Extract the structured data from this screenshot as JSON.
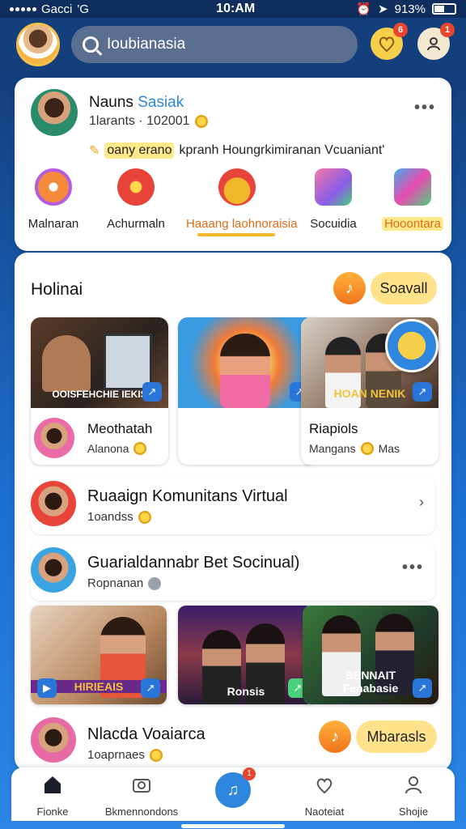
{
  "status_bar": {
    "carrier": "Gacci",
    "network": "'G",
    "time": "10:AM",
    "battery": "913%"
  },
  "header": {
    "search_placeholder": "Ioubianasia",
    "notif_badge": "6",
    "profile_badge": "1"
  },
  "profile": {
    "name": "Nauns",
    "name_accent": "Sasiak",
    "meta": "1larants · 102001",
    "promo_highlight": "oany erano",
    "promo_text": "kpranh Houngrkimiranan Vcuaniant'"
  },
  "categories": [
    {
      "label": "Malnaran",
      "color": "#f58a3a"
    },
    {
      "label": "Achurmaln",
      "color": "#e8443a"
    },
    {
      "label": "Haaang laohnoraisia",
      "color": "#f2b62a",
      "active": true
    },
    {
      "label": "Socuidia",
      "color": "#8a5be8"
    },
    {
      "label": "Hooontara",
      "color": "#3fb0e8",
      "highlight": true
    }
  ],
  "section": {
    "title": "Holinai",
    "scroll_label": "Soavall"
  },
  "thumb_cards": [
    {
      "caption": "OOISFEHCHIE\nIEKIS",
      "title": "Meothatah",
      "sub": "Alanona"
    },
    {
      "caption": "",
      "title": "",
      "sub": ""
    },
    {
      "caption": "HOAN\nNENIK",
      "title": "Riapiols",
      "sub": "Mangans",
      "sub2": "Mas"
    }
  ],
  "list_rows": [
    {
      "title": "Ruaaign Komunitans Virtual",
      "sub": "1oandss"
    },
    {
      "title": "Guarialdannabr Bet Socinual)",
      "sub": "Ropnanan"
    }
  ],
  "photos": [
    {
      "caption": "HIRIEAIS"
    },
    {
      "caption": "Ronsis"
    },
    {
      "caption": "BENNAIT\nFenabasie"
    }
  ],
  "bottom_row": {
    "title": "Nlacda Voaiarca",
    "sub": "1oaprnaes",
    "pill_label": "Mbarasls"
  },
  "nav": [
    {
      "label": "Fionke"
    },
    {
      "label": "Bkmennondons"
    },
    {
      "label": "Naoteiat"
    },
    {
      "label": "Shojie"
    }
  ],
  "nav_badge": "1"
}
